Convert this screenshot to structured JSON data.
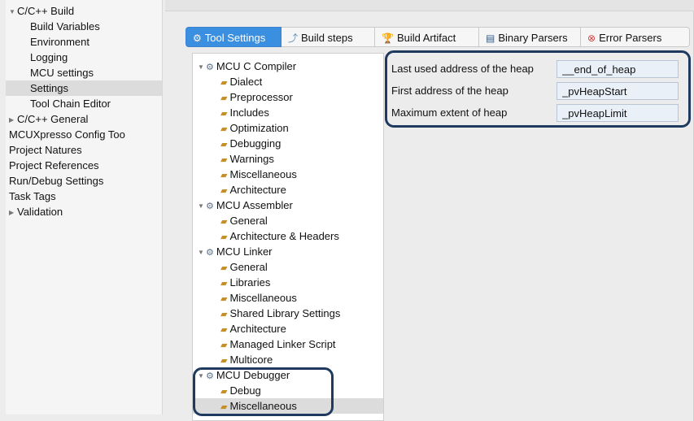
{
  "nav": {
    "items": [
      {
        "label": "C/C++ Build",
        "expanded": true
      },
      {
        "label": "Build Variables"
      },
      {
        "label": "Environment"
      },
      {
        "label": "Logging"
      },
      {
        "label": "MCU settings"
      },
      {
        "label": "Settings",
        "selected": true
      },
      {
        "label": "Tool Chain Editor"
      },
      {
        "label": "C/C++ General",
        "expandable": true
      },
      {
        "label": "MCUXpresso Config Too"
      },
      {
        "label": "Project Natures"
      },
      {
        "label": "Project References"
      },
      {
        "label": "Run/Debug Settings"
      },
      {
        "label": "Task Tags"
      },
      {
        "label": "Validation",
        "expandable": true
      }
    ]
  },
  "tabs": [
    {
      "label": "Tool Settings",
      "icon": "tool-settings-icon",
      "active": true
    },
    {
      "label": "Build steps",
      "icon": "build-steps-icon"
    },
    {
      "label": "Build Artifact",
      "icon": "build-artifact-icon"
    },
    {
      "label": "Binary Parsers",
      "icon": "binary-parsers-icon"
    },
    {
      "label": "Error Parsers",
      "icon": "error-parsers-icon"
    }
  ],
  "tree": {
    "compiler": {
      "label": "MCU C Compiler",
      "children": [
        "Dialect",
        "Preprocessor",
        "Includes",
        "Optimization",
        "Debugging",
        "Warnings",
        "Miscellaneous",
        "Architecture"
      ]
    },
    "assembler": {
      "label": "MCU Assembler",
      "children": [
        "General",
        "Architecture & Headers"
      ]
    },
    "linker": {
      "label": "MCU Linker",
      "children": [
        "General",
        "Libraries",
        "Miscellaneous",
        "Shared Library Settings",
        "Architecture",
        "Managed Linker Script",
        "Multicore"
      ]
    },
    "debugger": {
      "label": "MCU Debugger",
      "children": [
        "Debug",
        "Miscellaneous"
      ],
      "selected_child": "Miscellaneous"
    }
  },
  "heap": {
    "rows": [
      {
        "label": "Last used address of the heap",
        "value": "__end_of_heap"
      },
      {
        "label": "First address of the heap",
        "value": "_pvHeapStart"
      },
      {
        "label": "Maximum extent of heap",
        "value": "_pvHeapLimit"
      }
    ]
  },
  "colors": {
    "active_tab": "#3b8fe0",
    "highlight_outline": "#1f3a5f",
    "selection": "#dcdcdc"
  }
}
